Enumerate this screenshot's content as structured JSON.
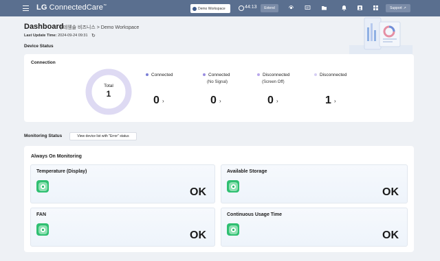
{
  "header": {
    "brand_prefix": "LG",
    "brand_name": "ConnectedCare",
    "brand_tm": "™",
    "workspace_pill": "Demo Workspace",
    "timer": "44:13",
    "extend_label": "Extend",
    "support_label": "Support",
    "icons": [
      "menu-icon",
      "clock-icon",
      "remote-icon",
      "message-icon",
      "folder-icon",
      "bell-icon",
      "user-icon",
      "apps-icon",
      "external-link-icon"
    ]
  },
  "page": {
    "title": "Dashboard",
    "breadcrumb": "| 테웬솔 비즈니스 > Demo Workspace",
    "last_update_label": "Last Update Time:",
    "last_update_value": "2024-09-24 09:31"
  },
  "device_status": {
    "section_label": "Device Status",
    "card_title": "Connection",
    "total_label": "Total",
    "total_value": "1",
    "items": [
      {
        "label": "Connected",
        "sub": "",
        "count": "0",
        "color": "#7b7fd6"
      },
      {
        "label": "Connected",
        "sub": "(No Signal)",
        "count": "0",
        "color": "#9a8ee0"
      },
      {
        "label": "Disconnected",
        "sub": "(Screen Off)",
        "count": "0",
        "color": "#b9a7ec"
      },
      {
        "label": "Disconnected",
        "sub": "",
        "count": "1",
        "color": "#d6cff3"
      }
    ],
    "donut_color": "#dedaf3"
  },
  "monitoring": {
    "section_label": "Monitoring Status",
    "error_button": "View device list with \"Error\" status",
    "card_title": "Always On Monitoring",
    "tiles": [
      {
        "name": "Temperature (Display)",
        "status": "OK"
      },
      {
        "name": "Available Storage",
        "status": "OK"
      },
      {
        "name": "FAN",
        "status": "OK"
      },
      {
        "name": "Continuous Usage Time",
        "status": "OK"
      }
    ],
    "ok_color": "#2fbf71"
  }
}
